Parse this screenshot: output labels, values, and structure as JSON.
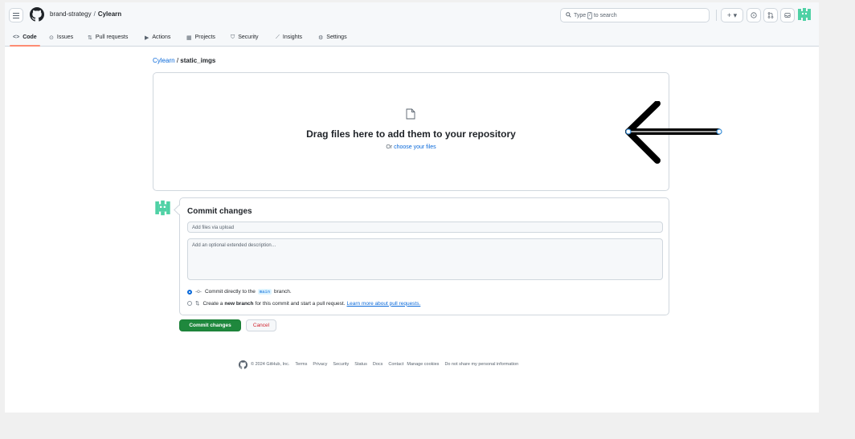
{
  "header": {
    "owner": "brand-strategy",
    "separator": "/",
    "repo": "Cylearn",
    "search_prefix": "Type",
    "search_key": "/",
    "search_suffix": "to search",
    "new_button": "+ ▾"
  },
  "tabs": [
    {
      "label": "Code",
      "icon": "code-icon",
      "glyph": "<>"
    },
    {
      "label": "Issues",
      "icon": "issues-icon",
      "glyph": "⊙"
    },
    {
      "label": "Pull requests",
      "icon": "pull-request-icon",
      "glyph": "⇅"
    },
    {
      "label": "Actions",
      "icon": "actions-icon",
      "glyph": "▶"
    },
    {
      "label": "Projects",
      "icon": "projects-icon",
      "glyph": "▦"
    },
    {
      "label": "Security",
      "icon": "shield-icon",
      "glyph": "⛉"
    },
    {
      "label": "Insights",
      "icon": "graph-icon",
      "glyph": "⟋"
    },
    {
      "label": "Settings",
      "icon": "gear-icon",
      "glyph": "⚙"
    }
  ],
  "breadcrumb": {
    "repo": "Cylearn",
    "separator": "/",
    "folder": "static_imgs"
  },
  "dropzone": {
    "title": "Drag files here to add them to your repository",
    "sub_prefix": "Or",
    "sub_link": "choose your files"
  },
  "commit": {
    "title": "Commit changes",
    "summary_placeholder": "Add files via upload",
    "description_placeholder": "Add an optional extended description…",
    "option_direct_prefix": "Commit directly to the",
    "option_direct_branch": "main",
    "option_direct_suffix": "branch.",
    "option_new_prefix": "Create a",
    "option_new_bold": "new branch",
    "option_new_suffix": "for this commit and start a pull request.",
    "option_new_link": "Learn more about pull requests.",
    "submit_label": "Commit changes",
    "cancel_label": "Cancel"
  },
  "footer": {
    "copyright": "© 2024 GitHub, Inc.",
    "links": [
      "Terms",
      "Privacy",
      "Security",
      "Status",
      "Docs",
      "Contact",
      "Manage cookies",
      "Do not share my personal information"
    ]
  },
  "colors": {
    "link": "#0969da",
    "primary_button": "#1f883d",
    "tab_underline": "#fd8c73",
    "avatar": "#4fd1a5"
  }
}
